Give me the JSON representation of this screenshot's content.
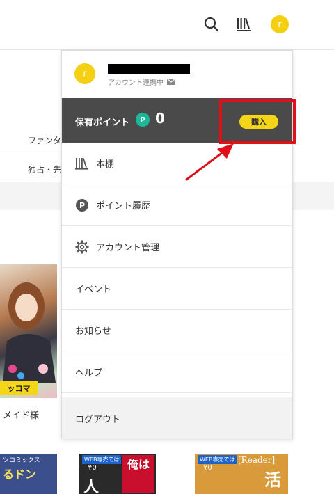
{
  "header": {
    "search_icon": "search-icon",
    "library_icon": "library-icon",
    "avatar_letter": "r"
  },
  "background": {
    "genre_1": "ファンタジ",
    "genre_2": "独占・先",
    "book_title": "メイド様",
    "cover_badge": "ッコマ",
    "cover_label_1": "ツコミックス",
    "cover_label_2": "るドン",
    "cover_label_3": "WEB専売では",
    "cover_label_4": "¥0",
    "cover_label_5": "俺は",
    "cover_label_6": "人",
    "cover_label_7": "[Reader]",
    "cover_label_8": "活",
    "cover_label_9": "WEB専売では",
    "cover_label_10": "¥0"
  },
  "dropdown": {
    "avatar_letter": "r",
    "account_status": "アカウント連携中",
    "points_label": "保有ポイント",
    "points_badge": "P",
    "points_value": "0",
    "buy_label": "購入",
    "items": [
      {
        "label": "本棚",
        "icon": "bookshelf-icon"
      },
      {
        "label": "ポイント履歴",
        "icon": "point-icon"
      },
      {
        "label": "アカウント管理",
        "icon": "gear-icon"
      },
      {
        "label": "イベント",
        "icon": ""
      },
      {
        "label": "お知らせ",
        "icon": ""
      },
      {
        "label": "ヘルプ",
        "icon": ""
      },
      {
        "label": "ログアウト",
        "icon": ""
      }
    ]
  },
  "colors": {
    "accent_yellow": "#f5cf12",
    "point_green": "#1bb99a",
    "highlight_red": "#e0101a",
    "dark_bar": "#4a4a4a"
  }
}
